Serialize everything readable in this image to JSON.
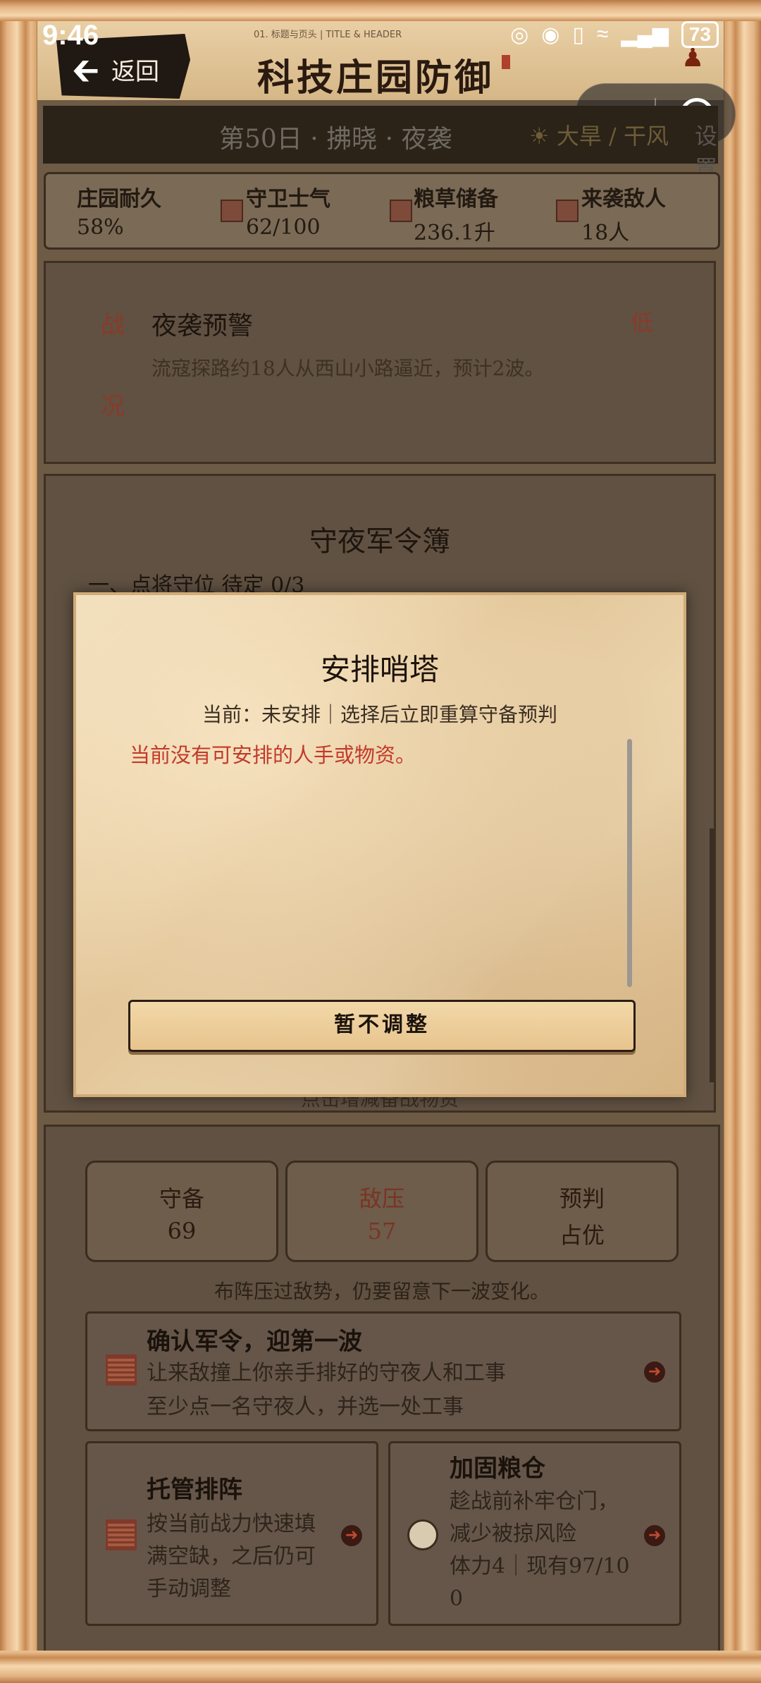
{
  "status_bar": {
    "time": "9:46",
    "network": "4G",
    "battery": "73"
  },
  "header": {
    "back_label": "返回",
    "subheader": "01. 标题与页头 | TITLE & HEADER",
    "title": "科技庄园防御"
  },
  "day_bar": {
    "day": "第50日 · 拂晓 · 夜袭",
    "weather": "大旱 / 干风",
    "settings": "设置"
  },
  "stats": [
    {
      "label": "庄园耐久",
      "value": "58%"
    },
    {
      "label": "守卫士气",
      "value": "62/100"
    },
    {
      "label": "粮草储备",
      "value": "236.1升"
    },
    {
      "label": "来袭敌人",
      "value": "18人"
    }
  ],
  "alert": {
    "tag1": "战",
    "tag2": "况",
    "title": "夜袭预警",
    "desc": "流寇探路约18人从西山小路逼近，预计2波。",
    "level": "低"
  },
  "book": {
    "title": "守夜军令簿",
    "section": "一、点将守位  待定 0/3",
    "footer": "点击增减备战物资"
  },
  "summary": [
    {
      "label": "守备",
      "value": "69"
    },
    {
      "label": "敌压",
      "value": "57"
    },
    {
      "label": "预判",
      "value": "占优"
    }
  ],
  "summary_note": "布阵压过敌势，仍要留意下一波变化。",
  "confirm": {
    "title": "确认军令，迎第一波",
    "line1": "让来敌撞上你亲手排好的守夜人和工事",
    "line2": "至少点一名守夜人，并选一处工事"
  },
  "auto": {
    "title": "托管排阵",
    "line1": "按当前战力快速填",
    "line2": "满空缺，之后仍可",
    "line3": "手动调整"
  },
  "granary": {
    "title": "加固粮仓",
    "line1": "趁战前补牢仓门，",
    "line2": "减少被掠风险",
    "line3": "体力4｜现有97/10",
    "line4": "0"
  },
  "modal": {
    "title": "安排哨塔",
    "current": "当前：未安排｜选择后立即重算守备预判",
    "empty": "当前没有可安排的人手或物资。",
    "button": "暂不调整"
  },
  "colors": {
    "accent_red": "#c23a2a",
    "parchment": "#e9d2aa",
    "dark_wood": "#2b2218"
  }
}
